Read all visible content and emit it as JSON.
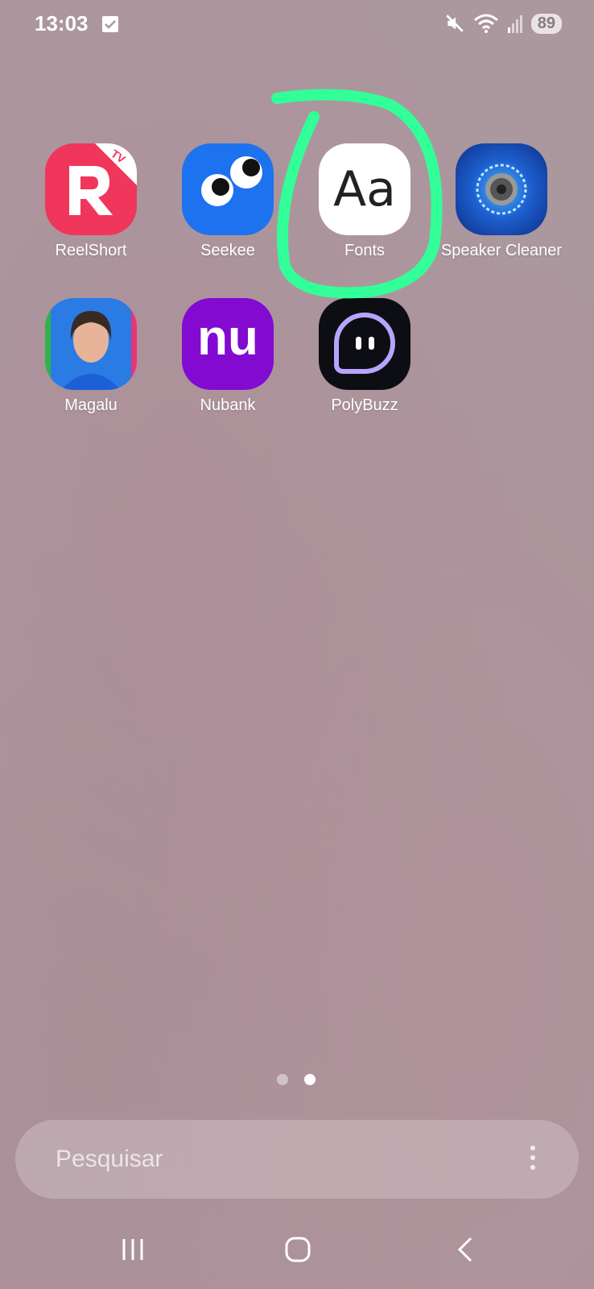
{
  "status": {
    "time": "13:03",
    "battery": "89"
  },
  "apps": [
    {
      "label": "ReelShort",
      "icon": "reelshort-icon",
      "badge": "TV"
    },
    {
      "label": "Seekee",
      "icon": "seekee-icon"
    },
    {
      "label": "Fonts",
      "icon": "fonts-icon",
      "glyph": "Aa"
    },
    {
      "label": "Speaker Cleaner",
      "icon": "speaker-cleaner-icon"
    },
    {
      "label": "Magalu",
      "icon": "magalu-icon"
    },
    {
      "label": "Nubank",
      "icon": "nubank-icon",
      "glyph": "nu"
    },
    {
      "label": "PolyBuzz",
      "icon": "polybuzz-icon"
    }
  ],
  "annotation": {
    "color": "#33ff99",
    "target": "Fonts"
  },
  "pages": {
    "count": 2,
    "active": 2
  },
  "search": {
    "placeholder": "Pesquisar"
  },
  "colors": {
    "reelshort": "#f0365a",
    "seekee": "#1d72f0",
    "nubank": "#820ad1",
    "polybuzz": "#0d0d14"
  }
}
